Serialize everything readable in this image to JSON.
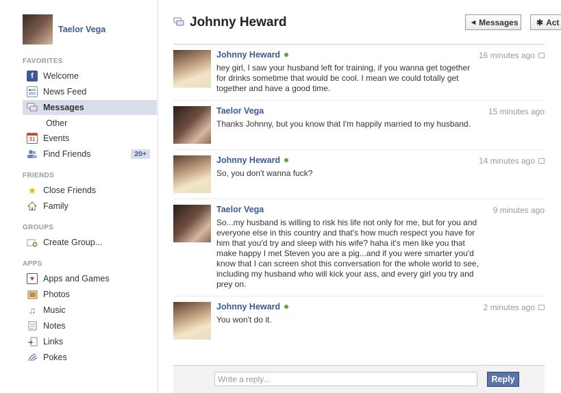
{
  "profile": {
    "name": "Taelor Vega"
  },
  "sidebar": {
    "favorites_head": "FAVORITES",
    "favorites": [
      {
        "label": "Welcome",
        "icon": "facebook-icon",
        "color": "#3b5998"
      },
      {
        "label": "News Feed",
        "icon": "news-feed-icon",
        "color": "#7f8ea9"
      },
      {
        "label": "Messages",
        "icon": "messages-icon",
        "color": "#8a6fa7",
        "selected": true
      },
      {
        "label": "Other",
        "sub": true
      },
      {
        "label": "Events",
        "icon": "calendar-icon",
        "color": "#c94b36",
        "glyph": "31"
      },
      {
        "label": "Find Friends",
        "icon": "friends-icon",
        "color": "#6d84b4",
        "badge": "20+"
      }
    ],
    "friends_head": "FRIENDS",
    "friends": [
      {
        "label": "Close Friends",
        "icon": "star-icon",
        "color": "#e6b800"
      },
      {
        "label": "Family",
        "icon": "house-icon",
        "color": "#8b6b3d"
      }
    ],
    "groups_head": "GROUPS",
    "groups": [
      {
        "label": "Create Group...",
        "icon": "add-group-icon",
        "color": "#6ca64a"
      }
    ],
    "apps_head": "APPS",
    "apps": [
      {
        "label": "Apps and Games",
        "icon": "apps-icon",
        "color": "#c0392b"
      },
      {
        "label": "Photos",
        "icon": "photos-icon",
        "color": "#a26b2f"
      },
      {
        "label": "Music",
        "icon": "music-icon",
        "color": "#6d84b4"
      },
      {
        "label": "Notes",
        "icon": "notes-icon",
        "color": "#888888"
      },
      {
        "label": "Links",
        "icon": "links-icon",
        "color": "#5a6f9c"
      },
      {
        "label": "Pokes",
        "icon": "pokes-icon",
        "color": "#6d84b4"
      }
    ]
  },
  "header": {
    "title": "Johnny Heward",
    "messages_button": "Messages",
    "actions_button": "Act"
  },
  "messages": [
    {
      "author": "Johnny Heward",
      "online": true,
      "time": "16 minutes ago",
      "avatar": "johnny",
      "text": "hey girl, I saw your husband left for training, if you wanna get together for drinks sometime that would be cool. I mean we could totally get together and have a good time."
    },
    {
      "author": "Taelor Vega",
      "online": false,
      "time": "15 minutes ago",
      "avatar": "taelor",
      "text": "Thanks Johnny, but you know that I'm happily married to my husband."
    },
    {
      "author": "Johnny Heward",
      "online": true,
      "time": "14 minutes ago",
      "avatar": "johnny",
      "text": "So, you don't wanna fuck?"
    },
    {
      "author": "Taelor Vega",
      "online": false,
      "time": "9 minutes ago",
      "avatar": "taelor",
      "text": "So...my husband is willing to risk his life not only for me, but for you and everyone else in this country and that's how much respect you have for him that you'd try and sleep with his wife? haha it's men like you that make happy I met Steven you are a pig...and if you were smarter you'd know that I can screen shot this conversation for the whole world to see, including my husband who will kick your ass, and every girl you try and prey on."
    },
    {
      "author": "Johnny Heward",
      "online": true,
      "time": "2 minutes ago",
      "avatar": "johnny",
      "text": "You won't do it."
    }
  ],
  "reply": {
    "placeholder": "Write a reply...",
    "button": "Reply"
  }
}
